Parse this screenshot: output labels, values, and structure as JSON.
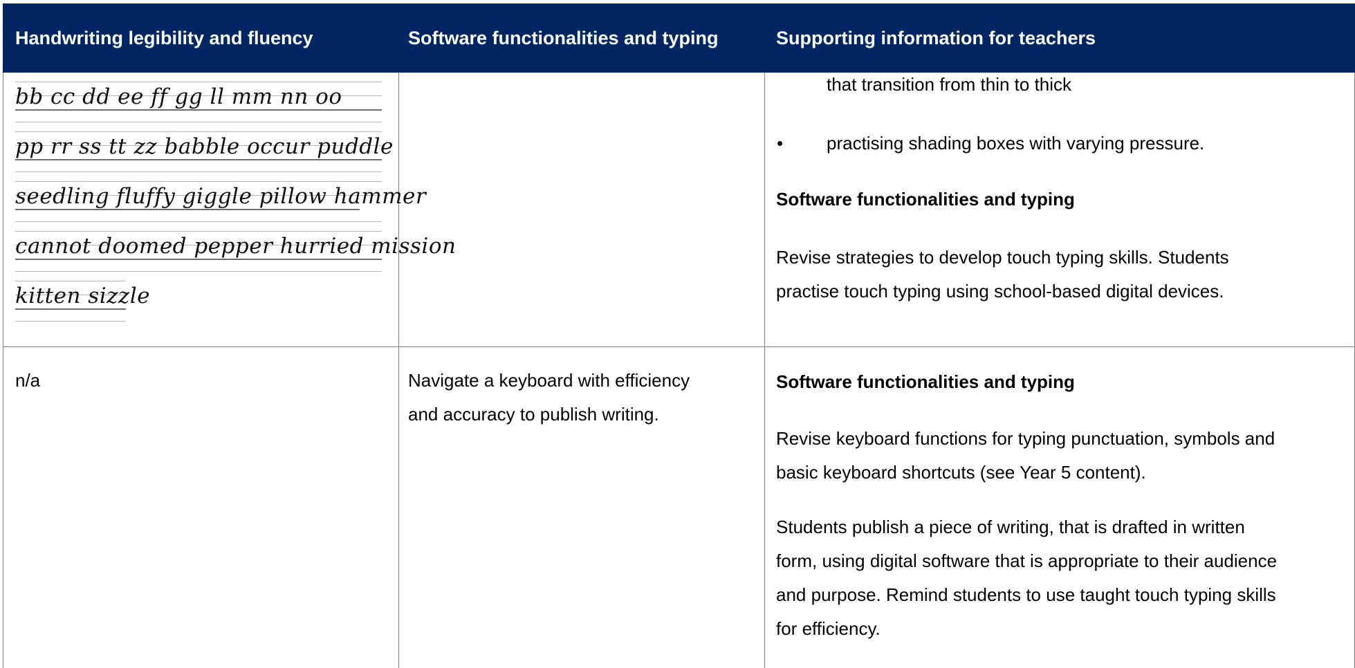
{
  "header": {
    "col1": "Handwriting legibility and fluency",
    "col2": "Software functionalities and typing",
    "col3": "Supporting information for teachers"
  },
  "row1": {
    "handwriting_lines": [
      "bb cc dd ee ff gg ll mm nn oo",
      "pp rr ss tt zz babble occur puddle",
      "seedling fluffy giggle pillow hammer",
      "cannot doomed pepper hurried mission",
      "kitten sizzle"
    ],
    "software": "",
    "support": {
      "continued_text": "that transition from thin to thick",
      "bullet_marker": "•",
      "bullet": "practising shading boxes with varying pressure.",
      "heading": "Software functionalities and typing",
      "paragraph_lines": [
        "Revise strategies to develop touch typing skills. Students",
        "practise touch typing using school-based digital devices."
      ]
    }
  },
  "row2": {
    "handwriting": "n/a",
    "software_lines": [
      "Navigate a keyboard with efficiency",
      "and accuracy to publish writing."
    ],
    "support": {
      "heading": "Software functionalities and typing",
      "paragraph1_lines": [
        "Revise keyboard functions for typing punctuation, symbols and",
        "basic keyboard shortcuts (see Year 5 content)."
      ],
      "paragraph2_lines": [
        "Students publish a piece of writing, that is drafted in written",
        "form, using digital software that is appropriate to their audience",
        "and purpose. Remind students to use taught touch typing skills",
        "for efficiency."
      ]
    }
  },
  "colors": {
    "header_bg": "#002664",
    "header_text": "#ffffff",
    "border": "#7f7f7f"
  }
}
